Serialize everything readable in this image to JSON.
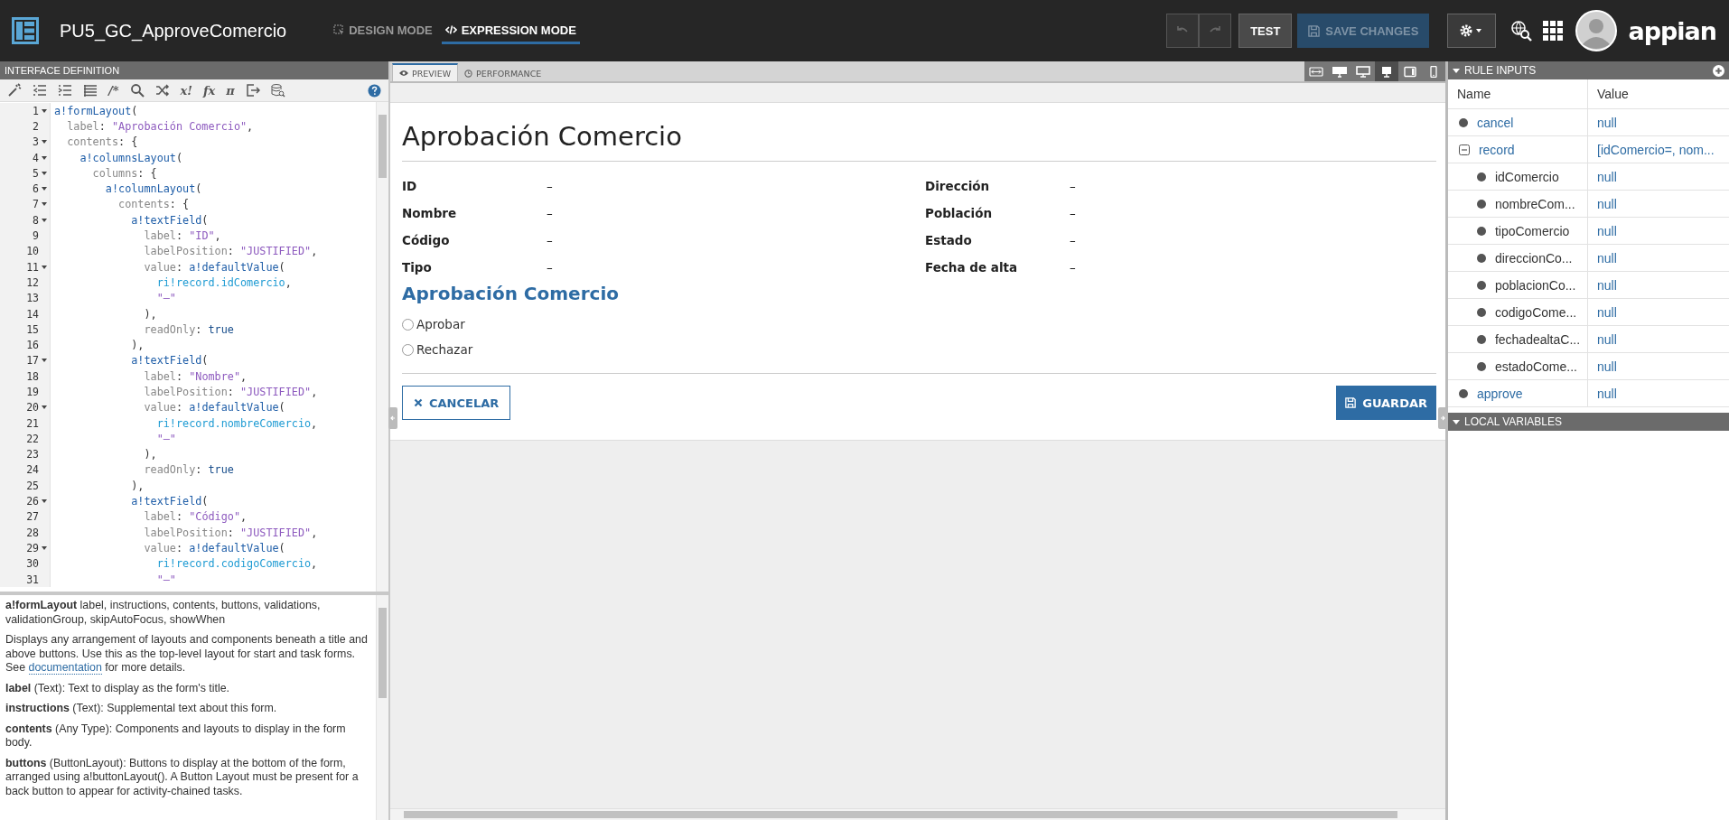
{
  "app_bar": {
    "title": "PU5_GC_ApproveComercio",
    "modes": [
      {
        "label": "DESIGN MODE",
        "kind": "design",
        "selected": false
      },
      {
        "label": "EXPRESSION MODE",
        "kind": "expression",
        "selected": true
      }
    ],
    "history": [
      {
        "kind": "undo",
        "disabled": true
      },
      {
        "kind": "redo",
        "disabled": true
      }
    ],
    "test_button": "TEST",
    "save_button": {
      "label": "SAVE CHANGES",
      "disabled": true
    },
    "logo": "appian"
  },
  "interface_definition": {
    "title": "INTERFACE DEFINITION",
    "tools": [
      {
        "kind": "wand"
      },
      {
        "kind": "outdent"
      },
      {
        "kind": "indent"
      },
      {
        "kind": "list"
      },
      {
        "kind": "glyph",
        "glyph": "/*"
      },
      {
        "kind": "search"
      },
      {
        "kind": "shuffle"
      },
      {
        "kind": "glyph",
        "glyph": "x!"
      },
      {
        "kind": "glyph",
        "glyph": "fx"
      },
      {
        "kind": "glyph",
        "glyph": "π"
      },
      {
        "kind": "export"
      },
      {
        "kind": "database"
      }
    ],
    "code_lines": [
      {
        "num": "1",
        "fold": true,
        "tokens": [
          {
            "kind": "fn",
            "text": "a!formLayout"
          },
          {
            "kind": "p",
            "text": "("
          }
        ]
      },
      {
        "num": "2",
        "fold": false,
        "tokens": [
          {
            "kind": "key",
            "text": "  label"
          },
          {
            "kind": "p",
            "text": ": "
          },
          {
            "kind": "str",
            "text": "\"Aprobación Comercio\""
          },
          {
            "kind": "p",
            "text": ","
          }
        ]
      },
      {
        "num": "3",
        "fold": true,
        "tokens": [
          {
            "kind": "key",
            "text": "  contents"
          },
          {
            "kind": "p",
            "text": ": {"
          }
        ]
      },
      {
        "num": "4",
        "fold": true,
        "tokens": [
          {
            "kind": "fn",
            "text": "    a!columnsLayout"
          },
          {
            "kind": "p",
            "text": "("
          }
        ]
      },
      {
        "num": "5",
        "fold": true,
        "tokens": [
          {
            "kind": "key",
            "text": "      columns"
          },
          {
            "kind": "p",
            "text": ": {"
          }
        ]
      },
      {
        "num": "6",
        "fold": true,
        "tokens": [
          {
            "kind": "fn",
            "text": "        a!columnLayout"
          },
          {
            "kind": "p",
            "text": "("
          }
        ]
      },
      {
        "num": "7",
        "fold": true,
        "tokens": [
          {
            "kind": "key",
            "text": "          contents"
          },
          {
            "kind": "p",
            "text": ": {"
          }
        ]
      },
      {
        "num": "8",
        "fold": true,
        "tokens": [
          {
            "kind": "fn",
            "text": "            a!textField"
          },
          {
            "kind": "p",
            "text": "("
          }
        ]
      },
      {
        "num": "9",
        "fold": false,
        "tokens": [
          {
            "kind": "key",
            "text": "              label"
          },
          {
            "kind": "p",
            "text": ": "
          },
          {
            "kind": "str",
            "text": "\"ID\""
          },
          {
            "kind": "p",
            "text": ","
          }
        ]
      },
      {
        "num": "10",
        "fold": false,
        "tokens": [
          {
            "kind": "key",
            "text": "              labelPosition"
          },
          {
            "kind": "p",
            "text": ": "
          },
          {
            "kind": "str",
            "text": "\"JUSTIFIED\""
          },
          {
            "kind": "p",
            "text": ","
          }
        ]
      },
      {
        "num": "11",
        "fold": true,
        "tokens": [
          {
            "kind": "key",
            "text": "              value"
          },
          {
            "kind": "p",
            "text": ": "
          },
          {
            "kind": "fn",
            "text": "a!defaultValue"
          },
          {
            "kind": "p",
            "text": "("
          }
        ]
      },
      {
        "num": "12",
        "fold": false,
        "tokens": [
          {
            "kind": "ri",
            "text": "                ri!record.idComercio"
          },
          {
            "kind": "p",
            "text": ","
          }
        ]
      },
      {
        "num": "13",
        "fold": false,
        "tokens": [
          {
            "kind": "str",
            "text": "                \"–\""
          }
        ]
      },
      {
        "num": "14",
        "fold": false,
        "tokens": [
          {
            "kind": "p",
            "text": "              ),"
          }
        ]
      },
      {
        "num": "15",
        "fold": false,
        "tokens": [
          {
            "kind": "key",
            "text": "              readOnly"
          },
          {
            "kind": "p",
            "text": ": "
          },
          {
            "kind": "bool",
            "text": "true"
          }
        ]
      },
      {
        "num": "16",
        "fold": false,
        "tokens": [
          {
            "kind": "p",
            "text": "            ),"
          }
        ]
      },
      {
        "num": "17",
        "fold": true,
        "tokens": [
          {
            "kind": "fn",
            "text": "            a!textField"
          },
          {
            "kind": "p",
            "text": "("
          }
        ]
      },
      {
        "num": "18",
        "fold": false,
        "tokens": [
          {
            "kind": "key",
            "text": "              label"
          },
          {
            "kind": "p",
            "text": ": "
          },
          {
            "kind": "str",
            "text": "\"Nombre\""
          },
          {
            "kind": "p",
            "text": ","
          }
        ]
      },
      {
        "num": "19",
        "fold": false,
        "tokens": [
          {
            "kind": "key",
            "text": "              labelPosition"
          },
          {
            "kind": "p",
            "text": ": "
          },
          {
            "kind": "str",
            "text": "\"JUSTIFIED\""
          },
          {
            "kind": "p",
            "text": ","
          }
        ]
      },
      {
        "num": "20",
        "fold": true,
        "tokens": [
          {
            "kind": "key",
            "text": "              value"
          },
          {
            "kind": "p",
            "text": ": "
          },
          {
            "kind": "fn",
            "text": "a!defaultValue"
          },
          {
            "kind": "p",
            "text": "("
          }
        ]
      },
      {
        "num": "21",
        "fold": false,
        "tokens": [
          {
            "kind": "ri",
            "text": "                ri!record.nombreComercio"
          },
          {
            "kind": "p",
            "text": ","
          }
        ]
      },
      {
        "num": "22",
        "fold": false,
        "tokens": [
          {
            "kind": "str",
            "text": "                \"–\""
          }
        ]
      },
      {
        "num": "23",
        "fold": false,
        "tokens": [
          {
            "kind": "p",
            "text": "              ),"
          }
        ]
      },
      {
        "num": "24",
        "fold": false,
        "tokens": [
          {
            "kind": "key",
            "text": "              readOnly"
          },
          {
            "kind": "p",
            "text": ": "
          },
          {
            "kind": "bool",
            "text": "true"
          }
        ]
      },
      {
        "num": "25",
        "fold": false,
        "tokens": [
          {
            "kind": "p",
            "text": "            ),"
          }
        ]
      },
      {
        "num": "26",
        "fold": true,
        "tokens": [
          {
            "kind": "fn",
            "text": "            a!textField"
          },
          {
            "kind": "p",
            "text": "("
          }
        ]
      },
      {
        "num": "27",
        "fold": false,
        "tokens": [
          {
            "kind": "key",
            "text": "              label"
          },
          {
            "kind": "p",
            "text": ": "
          },
          {
            "kind": "str",
            "text": "\"Código\""
          },
          {
            "kind": "p",
            "text": ","
          }
        ]
      },
      {
        "num": "28",
        "fold": false,
        "tokens": [
          {
            "kind": "key",
            "text": "              labelPosition"
          },
          {
            "kind": "p",
            "text": ": "
          },
          {
            "kind": "str",
            "text": "\"JUSTIFIED\""
          },
          {
            "kind": "p",
            "text": ","
          }
        ]
      },
      {
        "num": "29",
        "fold": true,
        "tokens": [
          {
            "kind": "key",
            "text": "              value"
          },
          {
            "kind": "p",
            "text": ": "
          },
          {
            "kind": "fn",
            "text": "a!defaultValue"
          },
          {
            "kind": "p",
            "text": "("
          }
        ]
      },
      {
        "num": "30",
        "fold": false,
        "tokens": [
          {
            "kind": "ri",
            "text": "                ri!record.codigoComercio"
          },
          {
            "kind": "p",
            "text": ","
          }
        ]
      },
      {
        "num": "31",
        "fold": false,
        "tokens": [
          {
            "kind": "str",
            "text": "                \"–\""
          }
        ]
      }
    ],
    "help": {
      "signature": "**a!formLayout**  label, instructions, contents, buttons, validations, validationGroup, skipAutoFocus, showWhen",
      "description_before": "Displays any arrangement of layouts and components beneath a title and above buttons. Use this as the top-level layout for start and task forms. See",
      "description_link": "documentation",
      "description_after": "for more details.",
      "params": [
        "**label** (Text): Text to display as the form's title.",
        "**instructions** (Text): Supplemental text about this form.",
        "**contents** (Any Type): Components and layouts to display in the form body.",
        "**buttons** (ButtonLayout): Buttons to display at the bottom of the form, arranged using a!buttonLayout(). A Button Layout must be present for a back button to appear for activity-chained tasks."
      ]
    }
  },
  "preview": {
    "tabs": [
      {
        "label": "PREVIEW",
        "kind": "eye",
        "selected": true
      },
      {
        "label": "PERFORMANCE",
        "kind": "clock",
        "selected": false
      }
    ],
    "devices": [
      {
        "kind": "fit",
        "selected": false
      },
      {
        "kind": "wide",
        "selected": false
      },
      {
        "kind": "desktop",
        "selected": false
      },
      {
        "kind": "monitor",
        "selected": true
      },
      {
        "kind": "tablet",
        "selected": false
      },
      {
        "kind": "phone",
        "selected": false
      }
    ],
    "form": {
      "title": "Aprobación Comercio",
      "columns": [
        [
          {
            "label": "ID",
            "value": "–"
          },
          {
            "label": "Nombre",
            "value": "–"
          },
          {
            "label": "Código",
            "value": "–"
          },
          {
            "label": "Tipo",
            "value": "–"
          }
        ],
        [
          {
            "label": "Dirección",
            "value": "–"
          },
          {
            "label": "Población",
            "value": "–"
          },
          {
            "label": "Estado",
            "value": "–"
          },
          {
            "label": "Fecha de alta",
            "value": "–"
          }
        ]
      ],
      "section_title": "Aprobación Comercio",
      "options": [
        {
          "label": "Aprobar",
          "selected": false
        },
        {
          "label": "Rechazar",
          "selected": false
        }
      ],
      "cancel_button": "CANCELAR",
      "save_button": "GUARDAR"
    }
  },
  "rule_inputs": {
    "title": "RULE INPUTS",
    "columns": [
      "Name",
      "Value"
    ],
    "rows": [
      {
        "name": "cancel",
        "value": "null"
      },
      {
        "name": "record",
        "value": "[idComercio=, nom...",
        "expanded": true,
        "children": [
          {
            "name": "idComercio",
            "value": "null"
          },
          {
            "name": "nombreCom...",
            "value": "null"
          },
          {
            "name": "tipoComercio",
            "value": "null"
          },
          {
            "name": "direccionCo...",
            "value": "null"
          },
          {
            "name": "poblacionCo...",
            "value": "null"
          },
          {
            "name": "codigoCome...",
            "value": "null"
          },
          {
            "name": "fechadealtaC...",
            "value": "null"
          },
          {
            "name": "estadoCome...",
            "value": "null"
          }
        ]
      },
      {
        "name": "approve",
        "value": "null"
      }
    ]
  },
  "local_variables": {
    "title": "LOCAL VARIABLES"
  }
}
